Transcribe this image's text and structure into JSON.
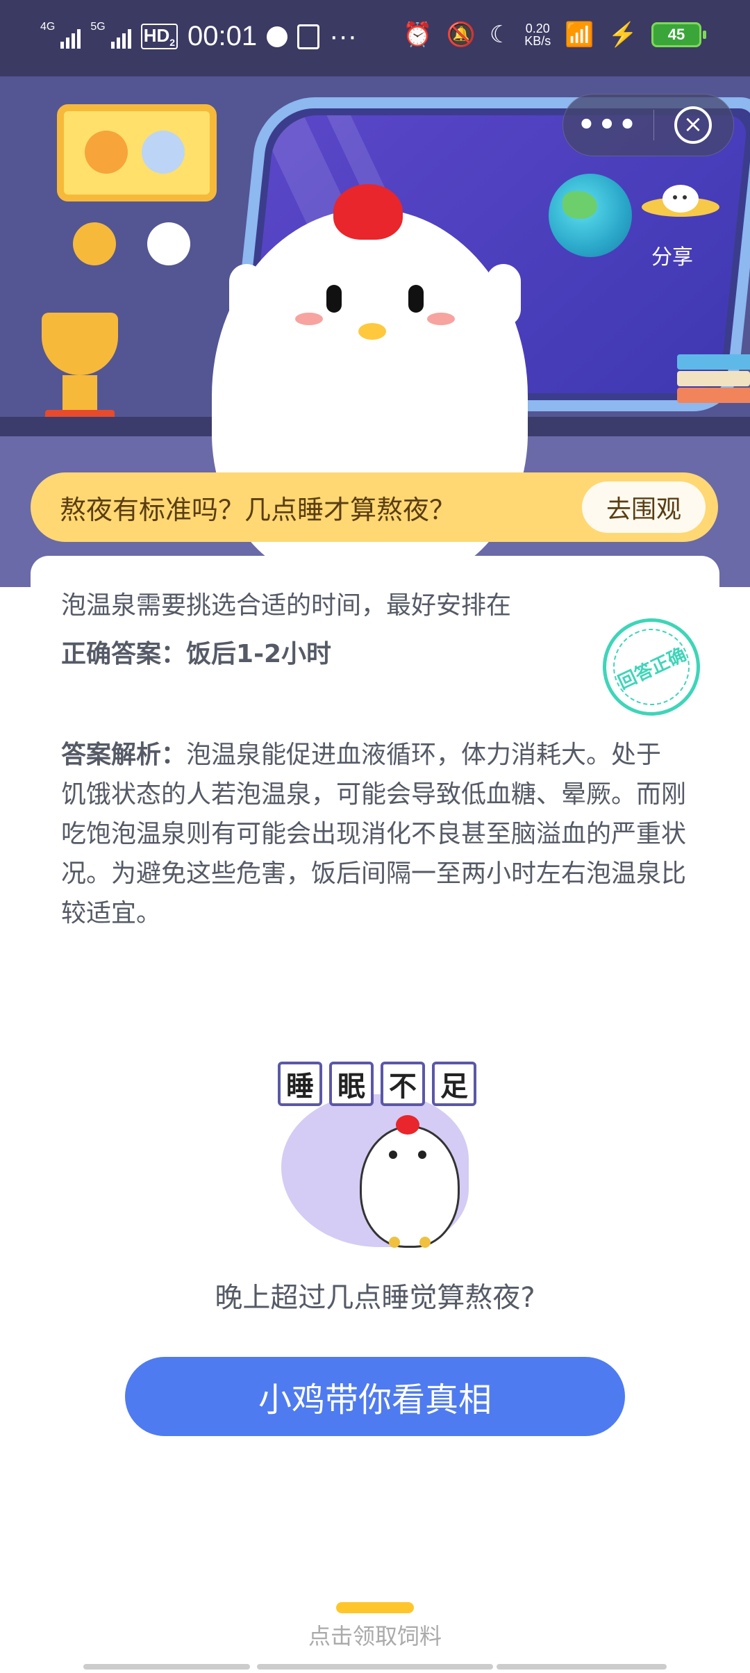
{
  "status_bar": {
    "network_1": "4G",
    "network_2": "5G",
    "hd_label": "HD",
    "hd_sub": "2",
    "time": "00:01",
    "overflow": "···",
    "speed_value": "0.20",
    "speed_unit": "KB/s",
    "battery": "45"
  },
  "mini_program": {
    "more_label": "•••",
    "close_glyph": "×",
    "share_label": "分享"
  },
  "topic": {
    "text": "熬夜有标准吗？几点睡才算熬夜？",
    "button_label": "去围观"
  },
  "quiz": {
    "question": "泡温泉需要挑选合适的时间，最好安排在",
    "answer_label": "正确答案：",
    "answer_value": "饭后1-2小时",
    "stamp_text": "回答正确",
    "explain_label": "答案解析：",
    "explain_text": "泡温泉能促进血液循环，体力消耗大。处于饥饿状态的人若泡温泉，可能会导致低血糖、晕厥。而刚吃饱泡温泉则有可能会出现消化不良甚至脑溢血的严重状况。为避免这些危害，饭后间隔一至两小时左右泡温泉比较适宜。"
  },
  "promo": {
    "chars": [
      "睡",
      "眠",
      "不",
      "足"
    ],
    "teaser": "晚上超过几点睡觉算熬夜?",
    "cta_label": "小鸡带你看真相"
  },
  "footer": {
    "feed_label": "点击领取饲料"
  },
  "colors": {
    "accent_blue": "#4f7bf0",
    "banner_yellow": "#ffd873",
    "stamp_teal": "#3ed5b8",
    "hero_bg": "#535693"
  }
}
